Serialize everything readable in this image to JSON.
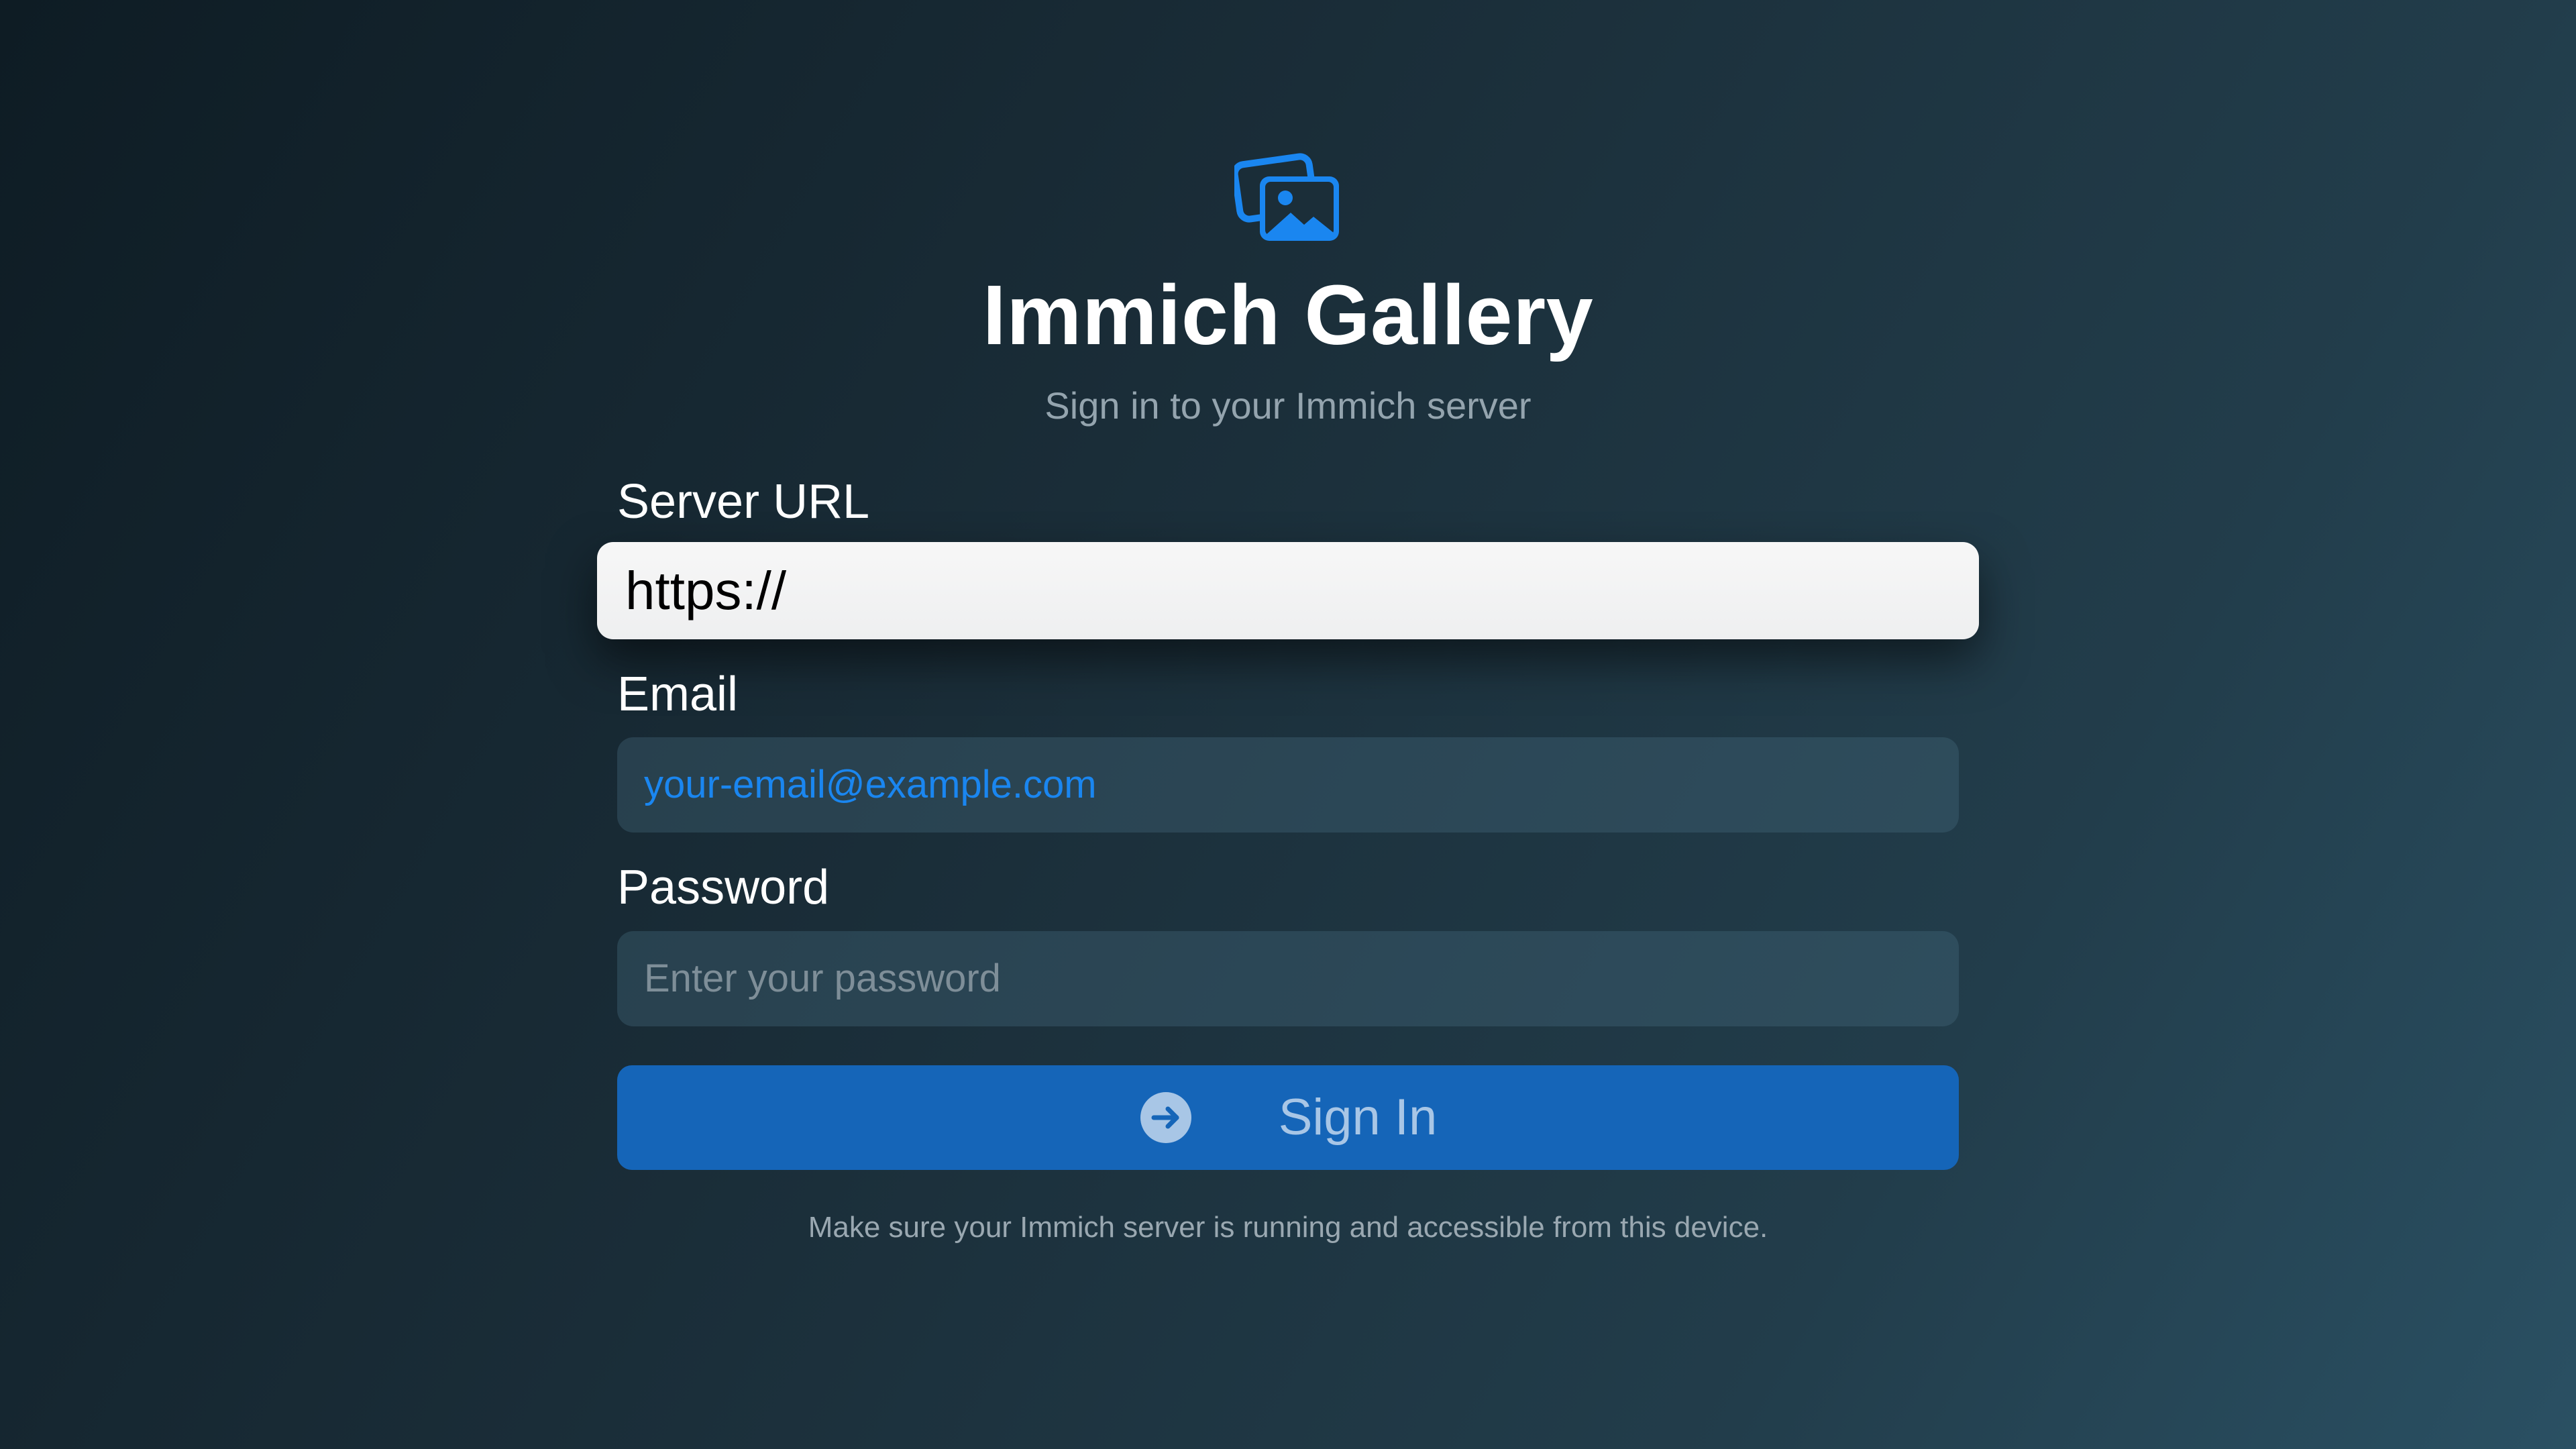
{
  "app": {
    "title": "Immich Gallery",
    "subtitle": "Sign in to your Immich server",
    "icon": "photo-stack-icon",
    "accent_color": "#1a86f0"
  },
  "form": {
    "server_url": {
      "label": "Server URL",
      "value": "https://",
      "focused": true
    },
    "email": {
      "label": "Email",
      "value": "your-email@example.com",
      "placeholder": "your-email@example.com"
    },
    "password": {
      "label": "Password",
      "value": "",
      "placeholder": "Enter your password"
    },
    "sign_in": {
      "label": "Sign In",
      "icon": "arrow-right-circle-icon",
      "color": "#1565b8"
    },
    "footer_note": "Make sure your Immich server is running and accessible from this device."
  }
}
